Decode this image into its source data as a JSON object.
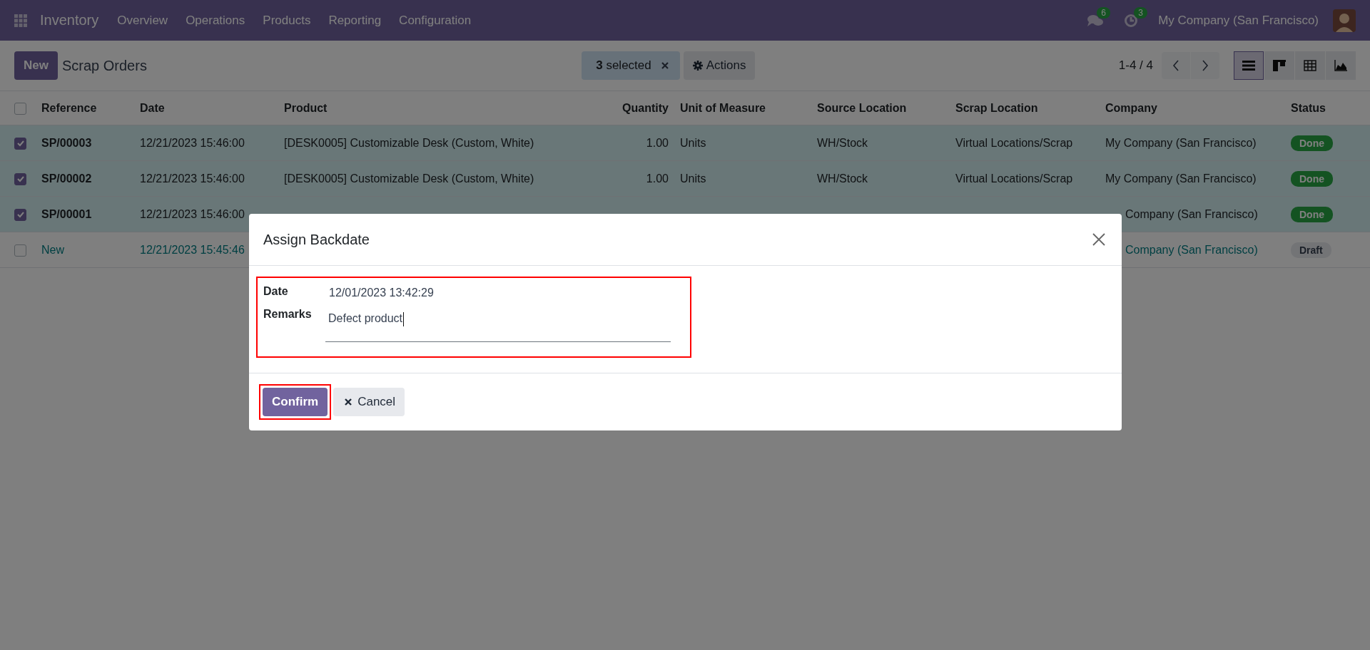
{
  "navbar": {
    "app_name": "Inventory",
    "menu": [
      "Overview",
      "Operations",
      "Products",
      "Reporting",
      "Configuration"
    ],
    "messages_count": "6",
    "activities_count": "3",
    "company": "My Company (San Francisco)"
  },
  "control_panel": {
    "new_button": "New",
    "title": "Scrap Orders",
    "selection": "**3** selected",
    "actions": "Actions",
    "pager": "1-4 / 4",
    "views": [
      {
        "kind": "list",
        "selected": true
      },
      {
        "kind": "kanban",
        "selected": false
      },
      {
        "kind": "pivot",
        "selected": false
      },
      {
        "kind": "graph",
        "selected": false
      }
    ]
  },
  "table": {
    "select_all": {
      "checked": false
    },
    "columns": [
      "Reference",
      "Date",
      "Product",
      "Quantity",
      "Unit of Measure",
      "Source Location",
      "Scrap Location",
      "Company",
      "Status"
    ],
    "rows": [
      {
        "selected": true,
        "reference": "SP/00003",
        "date": "12/21/2023 15:46:00",
        "product": "[DESK0005] Customizable Desk (Custom, White)",
        "quantity": "1.00",
        "uom": "Units",
        "source": "WH/Stock",
        "scrap": "Virtual Locations/Scrap",
        "company": "My Company (San Francisco)",
        "status": {
          "label": "Done",
          "kind": "done"
        }
      },
      {
        "selected": true,
        "reference": "SP/00002",
        "date": "12/21/2023 15:46:00",
        "product": "[DESK0005] Customizable Desk (Custom, White)",
        "quantity": "1.00",
        "uom": "Units",
        "source": "WH/Stock",
        "scrap": "Virtual Locations/Scrap",
        "company": "My Company (San Francisco)",
        "status": {
          "label": "Done",
          "kind": "done"
        }
      },
      {
        "selected": true,
        "reference": "SP/00001",
        "date": "12/21/2023 15:46:00",
        "company": "Company (San Francisco)",
        "status": {
          "label": "Done",
          "kind": "done"
        }
      },
      {
        "selected": false,
        "reference": "New",
        "date": "12/21/2023 15:45:46",
        "company": "Company (San Francisco)",
        "status": {
          "label": "Draft",
          "kind": "draft"
        }
      }
    ]
  },
  "dialog": {
    "title": "Assign Backdate",
    "highlighted": true,
    "fields": [
      {
        "label": "Date",
        "value": "12/01/2023 13:42:29",
        "kind": "text"
      },
      {
        "label": "Remarks",
        "value": "Defect product",
        "kind": "input"
      }
    ],
    "buttons": [
      {
        "label": "Confirm",
        "kind": "primary",
        "highlighted": true
      },
      {
        "label": "Cancel",
        "kind": "secondary",
        "highlighted": false
      }
    ]
  }
}
